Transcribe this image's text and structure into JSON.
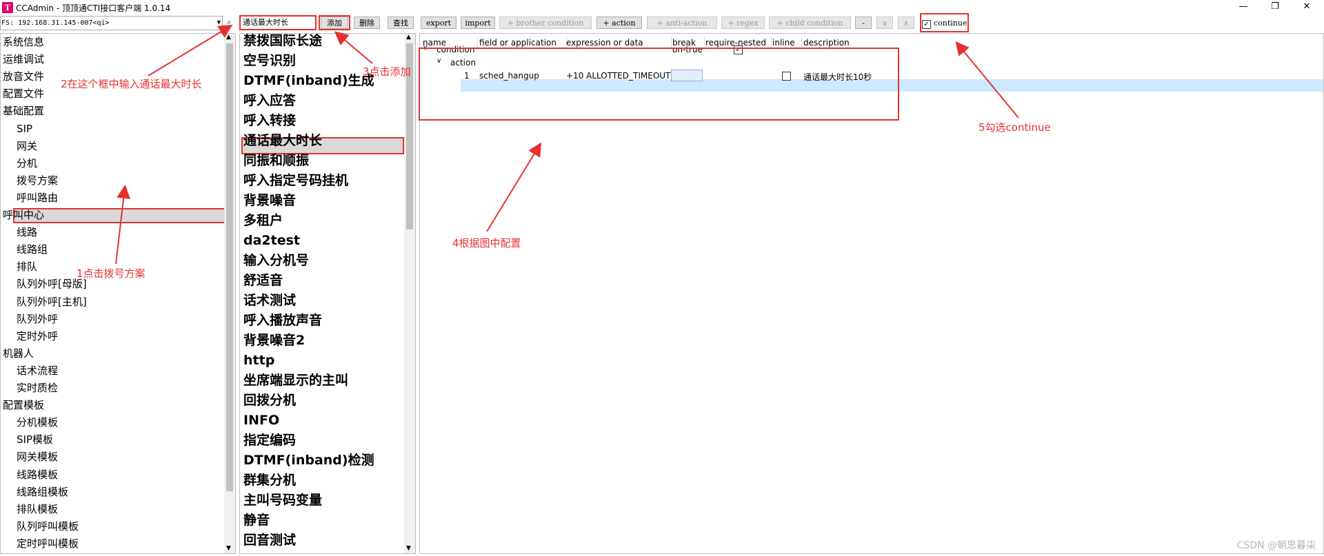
{
  "window": {
    "icon_letter": "T",
    "title": "CCAdmin - 顶顶通CTI接口客户端 1.0.14",
    "controls": {
      "minimize": "—",
      "maximize": "❐",
      "close": "✕"
    }
  },
  "toolbar": {
    "fs_value": "FS: 192.168.31.145-007<qi>",
    "search_value": "通话最大时长",
    "add_label": "添加",
    "delete_label": "删除",
    "find_label": "查找",
    "export_label": "export",
    "import_label": "import",
    "brother_condition_label": "+ brother condition",
    "action_label": "+ action",
    "anti_action_label": "+ anti-action",
    "regex_label": "+ regex",
    "child_condition_label": "+ child condition",
    "minus_label": "-",
    "down_label": "∨",
    "up_label": "∧",
    "continue_label": "continue",
    "continue_checked": true
  },
  "sidebar": {
    "items": [
      {
        "label": "系统信息",
        "level": 0
      },
      {
        "label": "运维调试",
        "level": 0
      },
      {
        "label": "放音文件",
        "level": 0
      },
      {
        "label": "配置文件",
        "level": 0
      },
      {
        "label": "基础配置",
        "level": 0
      },
      {
        "label": "SIP",
        "level": 1
      },
      {
        "label": "网关",
        "level": 1
      },
      {
        "label": "分机",
        "level": 1
      },
      {
        "label": "拨号方案",
        "level": 1,
        "selected": true
      },
      {
        "label": "呼叫路由",
        "level": 1
      },
      {
        "label": "呼叫中心",
        "level": 0
      },
      {
        "label": "线路",
        "level": 1
      },
      {
        "label": "线路组",
        "level": 1
      },
      {
        "label": "排队",
        "level": 1
      },
      {
        "label": "队列外呼[母版]",
        "level": 1
      },
      {
        "label": "队列外呼[主机]",
        "level": 1
      },
      {
        "label": "队列外呼",
        "level": 1
      },
      {
        "label": "定时外呼",
        "level": 1
      },
      {
        "label": "机器人",
        "level": 0
      },
      {
        "label": "话术流程",
        "level": 1
      },
      {
        "label": "实时质检",
        "level": 1
      },
      {
        "label": "配置模板",
        "level": 0
      },
      {
        "label": "分机模板",
        "level": 1
      },
      {
        "label": "SIP模板",
        "level": 1
      },
      {
        "label": "网关模板",
        "level": 1
      },
      {
        "label": "线路模板",
        "level": 1
      },
      {
        "label": "线路组模板",
        "level": 1
      },
      {
        "label": "排队模板",
        "level": 1
      },
      {
        "label": "队列呼叫模板",
        "level": 1
      },
      {
        "label": "定时呼叫模板",
        "level": 1
      }
    ]
  },
  "dialplans": {
    "items": [
      "禁拨国际长途",
      "空号识别",
      "DTMF(inband)生成",
      "呼入应答",
      "呼入转接",
      "通话最大时长",
      "同振和顺振",
      "呼入指定号码挂机",
      "背景噪音",
      "多租户",
      "da2test",
      "输入分机号",
      "舒适音",
      "话术测试",
      "呼入播放声音",
      "背景噪音2",
      "http",
      "坐席端显示的主叫",
      "回拨分机",
      "INFO",
      "指定编码",
      "DTMF(inband)检测",
      "群集分机",
      "主叫号码变量",
      "静音",
      "回音测试"
    ],
    "selected": "通话最大时长"
  },
  "detail": {
    "columns": [
      "name",
      "field or application",
      "expression or data",
      "break",
      "require-nested",
      "inline",
      "description"
    ],
    "condition": {
      "name": "condition",
      "break": "on-true",
      "require_nested": true
    },
    "action_group": {
      "name": "action"
    },
    "action_row": {
      "index": "1",
      "application": "sched_hangup",
      "data": "+10 ALLOTTED_TIMEOUT",
      "inline": false,
      "description": "通话最大时长10秒"
    }
  },
  "annotations": {
    "step1": "1点击拨号方案",
    "step2": "2在这个框中输入通话最大时长",
    "step3": "3点击添加",
    "step4": "4根据图中配置",
    "step5": "5勾选continue"
  },
  "watermark": "CSDN @朝思暮柒",
  "colors": {
    "annotation": "#e63030",
    "selection": "#d9d9d9",
    "row_highlight": "#cde8ff"
  }
}
